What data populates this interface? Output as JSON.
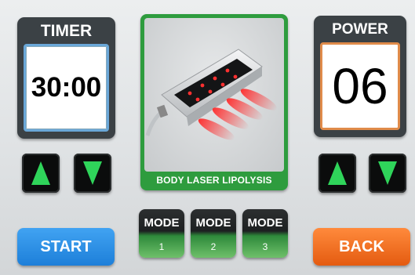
{
  "timer": {
    "label": "TIMER",
    "value": "30:00"
  },
  "power": {
    "label": "POWER",
    "value": "06"
  },
  "treatment": {
    "caption": "BODY LASER LIPOLYSIS"
  },
  "modes": [
    {
      "title": "MODE",
      "number": "1"
    },
    {
      "title": "MODE",
      "number": "2"
    },
    {
      "title": "MODE",
      "number": "3"
    }
  ],
  "actions": {
    "start_label": "START",
    "back_label": "BACK"
  },
  "icons": {
    "up": "arrow-up-icon",
    "down": "arrow-down-icon"
  },
  "colors": {
    "arrow_green": "#2fd45a",
    "start_blue": "#1d7fd9",
    "back_orange": "#e45b10",
    "image_frame_green": "#2e9c3e"
  }
}
